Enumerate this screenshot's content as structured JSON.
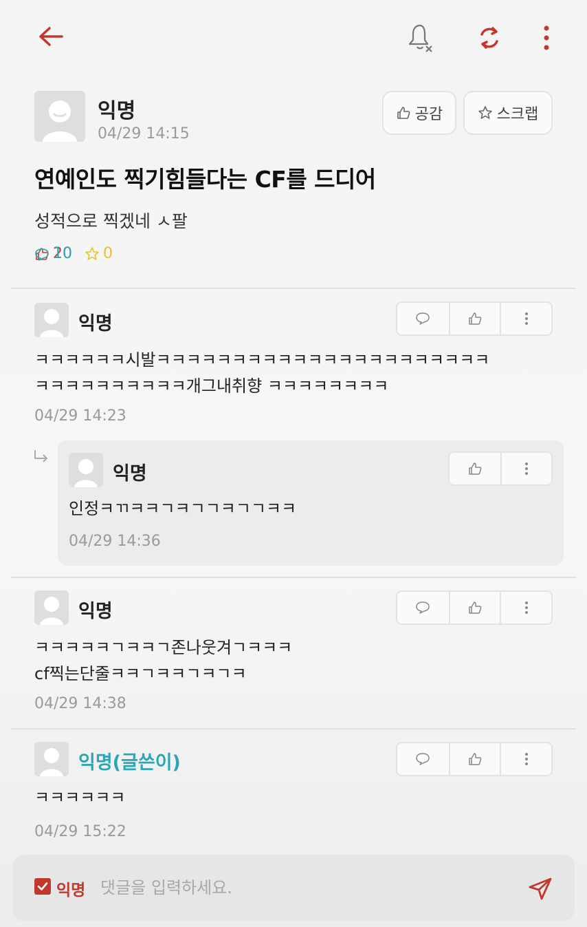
{
  "colors": {
    "accent": "#c0392b",
    "teal": "#2aa7b3",
    "star": "#e6c32b",
    "muted": "#9a9a9a"
  },
  "topbar": {
    "back_icon": "arrow-left-icon",
    "bell_icon": "bell-off-icon",
    "refresh_icon": "refresh-icon",
    "more_icon": "more-vertical-icon"
  },
  "post": {
    "author": "익명",
    "date": "04/29 14:15",
    "like_button": "공감",
    "scrap_button": "스크랩",
    "title": "연예인도 찍기힘들다는 CF를 드디어",
    "body": "성적으로 찍겠네 ㅅ팔",
    "stats": {
      "likes": "20",
      "comments": "10",
      "scraps": "0"
    }
  },
  "comments": [
    {
      "author": "익명",
      "lines": [
        "ㅋㅋㅋㅋㅋㅋ시발ㅋㅋㅋㅋㅋㅋㅋㅋㅋㅋㅋㅋㅋㅋㅋㅋㅋㅋㅋㅋㅋㅋ",
        "ㅋㅋㅋㅋㅋㅋㅋㅋㅋㅋ개그내취향 ㅋㅋㅋㅋㅋㅋㅋㅋ"
      ],
      "date": "04/29 14:23"
    },
    {
      "author": "익명",
      "lines": [
        "인정ㅋㄲㅋㅋㄱㅋㄱㄱㅋㄱㄱㅋㅋ"
      ],
      "date": "04/29 14:36"
    },
    {
      "author": "익명",
      "lines": [
        "ㅋㅋㅋㅋㅋㄱㅋㅋㄱ존나웃겨ㄱㅋㅋㅋ",
        "cf찍는단줄ㅋㅋㄱㅋㅋㄱㅋㄱㅋ"
      ],
      "date": "04/29 14:38"
    },
    {
      "author": "익명(글쓴이)",
      "lines": [
        "ㅋㅋㅋㅋㅋㅋ"
      ],
      "date": "04/29 15:22"
    }
  ],
  "input": {
    "anon_label": "익명",
    "placeholder": "댓글을 입력하세요."
  }
}
